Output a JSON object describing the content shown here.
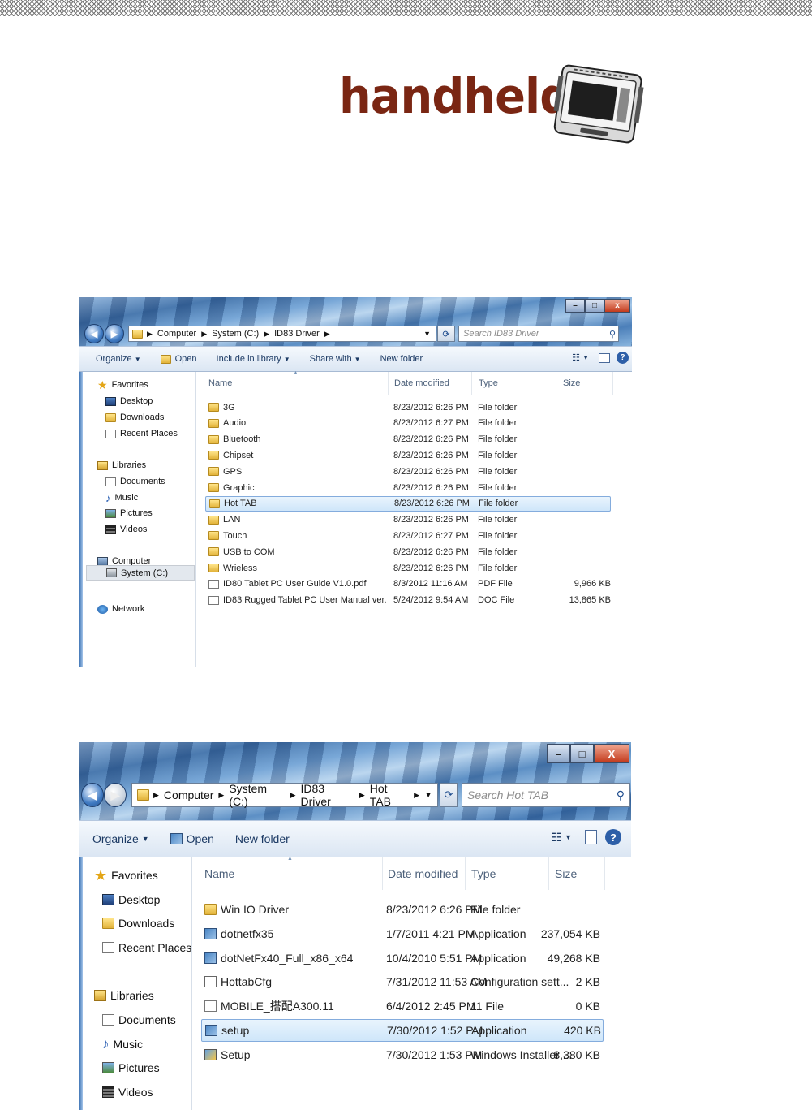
{
  "logo": {
    "text": "handheld"
  },
  "window1": {
    "caption": {
      "minimize": "–",
      "maximize": "□",
      "close": "x"
    },
    "breadcrumb": [
      "Computer",
      "System (C:)",
      "ID83 Driver"
    ],
    "search_placeholder": "Search ID83 Driver",
    "toolbar": {
      "organize": "Organize",
      "open": "Open",
      "include": "Include in library",
      "share": "Share with",
      "new_folder": "New folder"
    },
    "nav": {
      "favorites": "Favorites",
      "desktop": "Desktop",
      "downloads": "Downloads",
      "recent": "Recent Places",
      "libraries": "Libraries",
      "documents": "Documents",
      "music": "Music",
      "pictures": "Pictures",
      "videos": "Videos",
      "computer": "Computer",
      "system": "System (C:)",
      "network": "Network"
    },
    "columns": {
      "name": "Name",
      "date": "Date modified",
      "type": "Type",
      "size": "Size"
    },
    "files": [
      {
        "name": "3G",
        "date": "8/23/2012 6:26 PM",
        "type": "File folder",
        "size": ""
      },
      {
        "name": "Audio",
        "date": "8/23/2012 6:27 PM",
        "type": "File folder",
        "size": ""
      },
      {
        "name": "Bluetooth",
        "date": "8/23/2012 6:26 PM",
        "type": "File folder",
        "size": ""
      },
      {
        "name": "Chipset",
        "date": "8/23/2012 6:26 PM",
        "type": "File folder",
        "size": ""
      },
      {
        "name": "GPS",
        "date": "8/23/2012 6:26 PM",
        "type": "File folder",
        "size": ""
      },
      {
        "name": "Graphic",
        "date": "8/23/2012 6:26 PM",
        "type": "File folder",
        "size": ""
      },
      {
        "name": "Hot TAB",
        "date": "8/23/2012 6:26 PM",
        "type": "File folder",
        "size": ""
      },
      {
        "name": "LAN",
        "date": "8/23/2012 6:26 PM",
        "type": "File folder",
        "size": ""
      },
      {
        "name": "Touch",
        "date": "8/23/2012 6:27 PM",
        "type": "File folder",
        "size": ""
      },
      {
        "name": "USB to COM",
        "date": "8/23/2012 6:26 PM",
        "type": "File folder",
        "size": ""
      },
      {
        "name": "Wrieless",
        "date": "8/23/2012 6:26 PM",
        "type": "File folder",
        "size": ""
      },
      {
        "name": "ID80 Tablet PC User Guide V1.0.pdf",
        "date": "8/3/2012 11:16 AM",
        "type": "PDF File",
        "size": "9,966 KB"
      },
      {
        "name": "ID83 Rugged Tablet PC  User Manual ver...",
        "date": "5/24/2012 9:54 AM",
        "type": "DOC File",
        "size": "13,865 KB"
      }
    ]
  },
  "window2": {
    "caption": {
      "minimize": "–",
      "maximize": "□",
      "close": "X"
    },
    "breadcrumb": [
      "Computer",
      "System (C:)",
      "ID83 Driver",
      "Hot TAB"
    ],
    "search_placeholder": "Search Hot TAB",
    "toolbar": {
      "organize": "Organize",
      "open": "Open",
      "new_folder": "New folder"
    },
    "nav": {
      "favorites": "Favorites",
      "desktop": "Desktop",
      "downloads": "Downloads",
      "recent": "Recent Places",
      "libraries": "Libraries",
      "documents": "Documents",
      "music": "Music",
      "pictures": "Pictures",
      "videos": "Videos"
    },
    "columns": {
      "name": "Name",
      "date": "Date modified",
      "type": "Type",
      "size": "Size"
    },
    "files": [
      {
        "name": "Win IO Driver",
        "date": "8/23/2012 6:26 PM",
        "type": "File folder",
        "size": ""
      },
      {
        "name": "dotnetfx35",
        "date": "1/7/2011 4:21 PM",
        "type": "Application",
        "size": "237,054 KB"
      },
      {
        "name": "dotNetFx40_Full_x86_x64",
        "date": "10/4/2010 5:51 PM",
        "type": "Application",
        "size": "49,268 KB"
      },
      {
        "name": "HottabCfg",
        "date": "7/31/2012 11:53 AM",
        "type": "Configuration sett...",
        "size": "2 KB"
      },
      {
        "name": "MOBILE_搭配A300.11",
        "date": "6/4/2012 2:45 PM",
        "type": "11 File",
        "size": "0 KB"
      },
      {
        "name": "setup",
        "date": "7/30/2012 1:52 PM",
        "type": "Application",
        "size": "420 KB"
      },
      {
        "name": "Setup",
        "date": "7/30/2012 1:53 PM",
        "type": "Windows Installer ...",
        "size": "8,380 KB"
      }
    ]
  }
}
